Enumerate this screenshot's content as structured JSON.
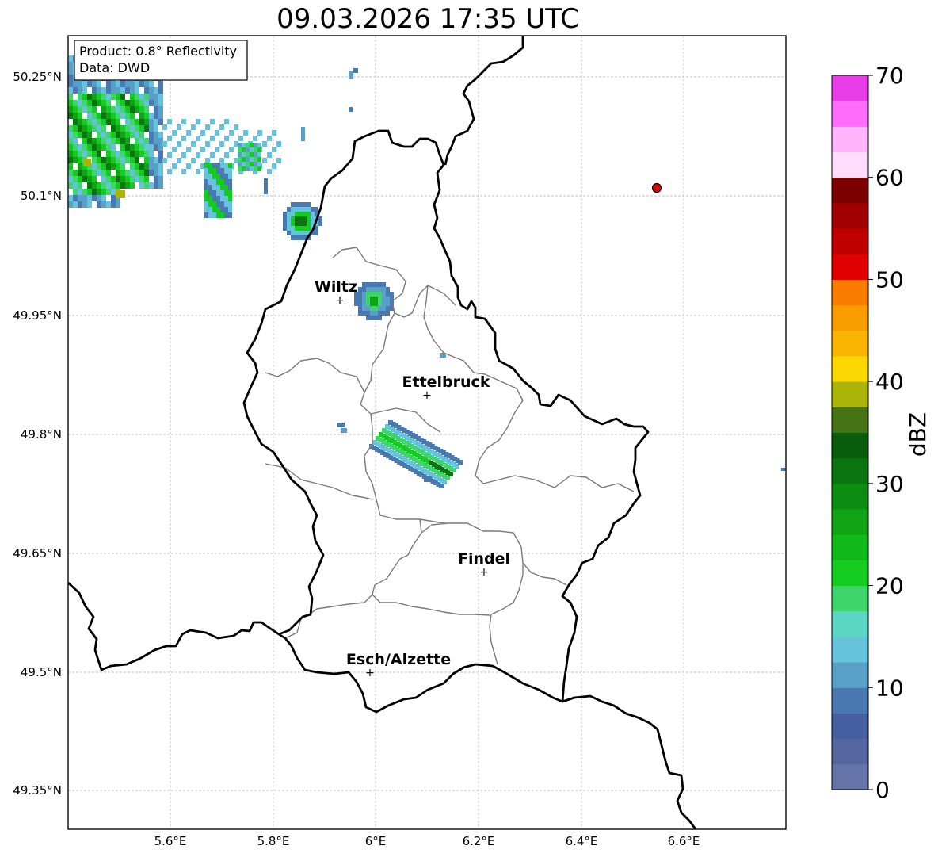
{
  "title": "09.03.2026 17:35 UTC",
  "info_box": {
    "product": "Product: 0.8° Reflectivity",
    "data_source": "Data: DWD"
  },
  "x_ticks": [
    "5.6°E",
    "5.8°E",
    "6°E",
    "6.2°E",
    "6.4°E",
    "6.6°E"
  ],
  "y_ticks": [
    "50.25°N",
    "50.1°N",
    "49.95°N",
    "49.8°N",
    "49.65°N",
    "49.5°N",
    "49.35°N"
  ],
  "cities": [
    {
      "name": "Wiltz"
    },
    {
      "name": "Ettelbruck"
    },
    {
      "name": "Findel"
    },
    {
      "name": "Esch/Alzette"
    }
  ],
  "colorbar": {
    "title": "dBZ",
    "tick_labels": [
      "0",
      "10",
      "20",
      "30",
      "40",
      "50",
      "60",
      "70"
    ],
    "colors": [
      "#6474a8",
      "#53679e",
      "#4460a0",
      "#4a78b0",
      "#58a0c8",
      "#66c3dc",
      "#5cd6c4",
      "#3ed66a",
      "#14cc20",
      "#10b81a",
      "#10a414",
      "#0c8c10",
      "#0a7410",
      "#085c0c",
      "#467414",
      "#acb408",
      "#f8d800",
      "#f8b400",
      "#f89c00",
      "#fc7c00",
      "#e00000",
      "#c00000",
      "#a00000",
      "#7c0000",
      "#ffdcfc",
      "#ffb4fc",
      "#ff6cfc",
      "#e83ce8"
    ]
  },
  "radar_marker": {
    "color": "#e00000"
  }
}
